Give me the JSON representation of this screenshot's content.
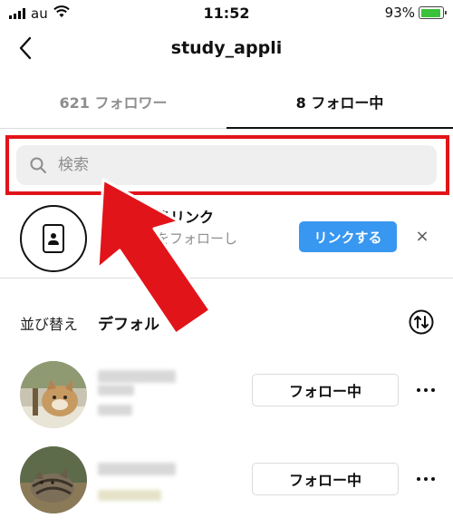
{
  "status_bar": {
    "carrier": "au",
    "time": "11:52",
    "battery": "93%",
    "battery_level": 0.93
  },
  "header": {
    "title": "study_appli"
  },
  "tabs": [
    {
      "label": "621 フォロワー",
      "active": false
    },
    {
      "label": "8 フォロー中",
      "active": true
    }
  ],
  "search": {
    "placeholder": "検索",
    "value": ""
  },
  "contacts": {
    "title": "連絡先をリンク",
    "title_visible": "きリンク",
    "subtitle": "をフォローし",
    "button_label": "リンクする",
    "dismiss_label": "×"
  },
  "sort": {
    "label": "並び替え",
    "value": "デフォル"
  },
  "following": [
    {
      "button_label": "フォロー中",
      "more_label": "•••"
    },
    {
      "button_label": "フォロー中",
      "more_label": "•••"
    }
  ],
  "colors": {
    "highlight": "#e1141a",
    "link_button": "#3897f0",
    "arrow": "#e1141a"
  }
}
